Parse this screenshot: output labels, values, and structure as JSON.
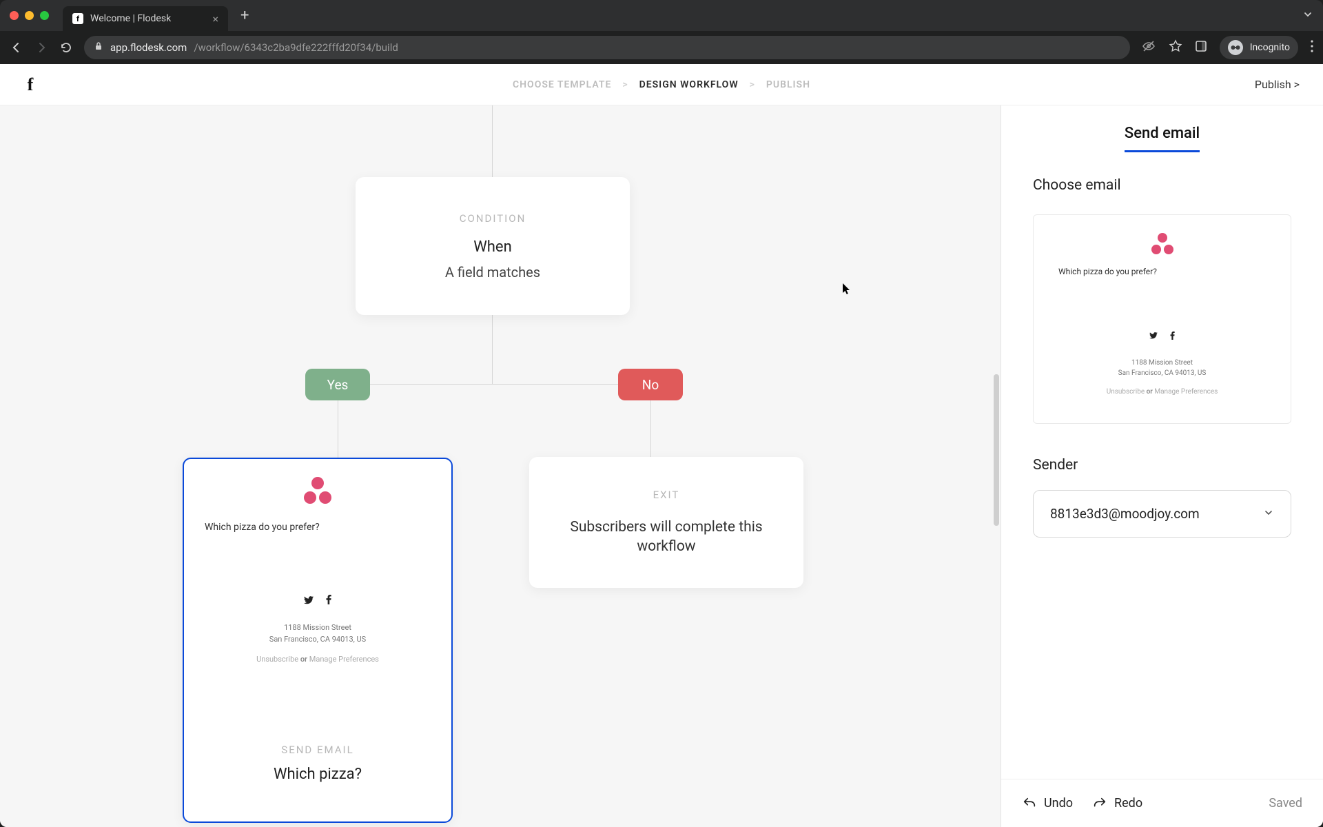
{
  "browser": {
    "tab_title": "Welcome | Flodesk",
    "url_host": "app.flodesk.com",
    "url_path": "/workflow/6343c2ba9dfe222fffd20f34/build",
    "incognito_label": "Incognito"
  },
  "header": {
    "breadcrumbs": [
      "CHOOSE TEMPLATE",
      "DESIGN WORKFLOW",
      "PUBLISH"
    ],
    "active_breadcrumb_index": 1,
    "publish_label": "Publish >"
  },
  "workflow": {
    "condition": {
      "label": "CONDITION",
      "title": "When",
      "subtitle": "A field matches"
    },
    "yes_label": "Yes",
    "no_label": "No",
    "exit": {
      "label": "EXIT",
      "text": "Subscribers will complete this workflow"
    },
    "email_node": {
      "label": "SEND EMAIL",
      "title": "Which pizza?"
    },
    "email_preview": {
      "question": "Which pizza do you prefer?",
      "address_line1": "1188 Mission Street",
      "address_line2": "San Francisco, CA 94013, US",
      "unsubscribe": "Unsubscribe",
      "or": "or",
      "manage": "Manage Preferences"
    }
  },
  "panel": {
    "tab_label": "Send email",
    "choose_email_label": "Choose email",
    "sender_label": "Sender",
    "sender_value": "8813e3d3@moodjoy.com",
    "undo_label": "Undo",
    "redo_label": "Redo",
    "saved_label": "Saved"
  }
}
